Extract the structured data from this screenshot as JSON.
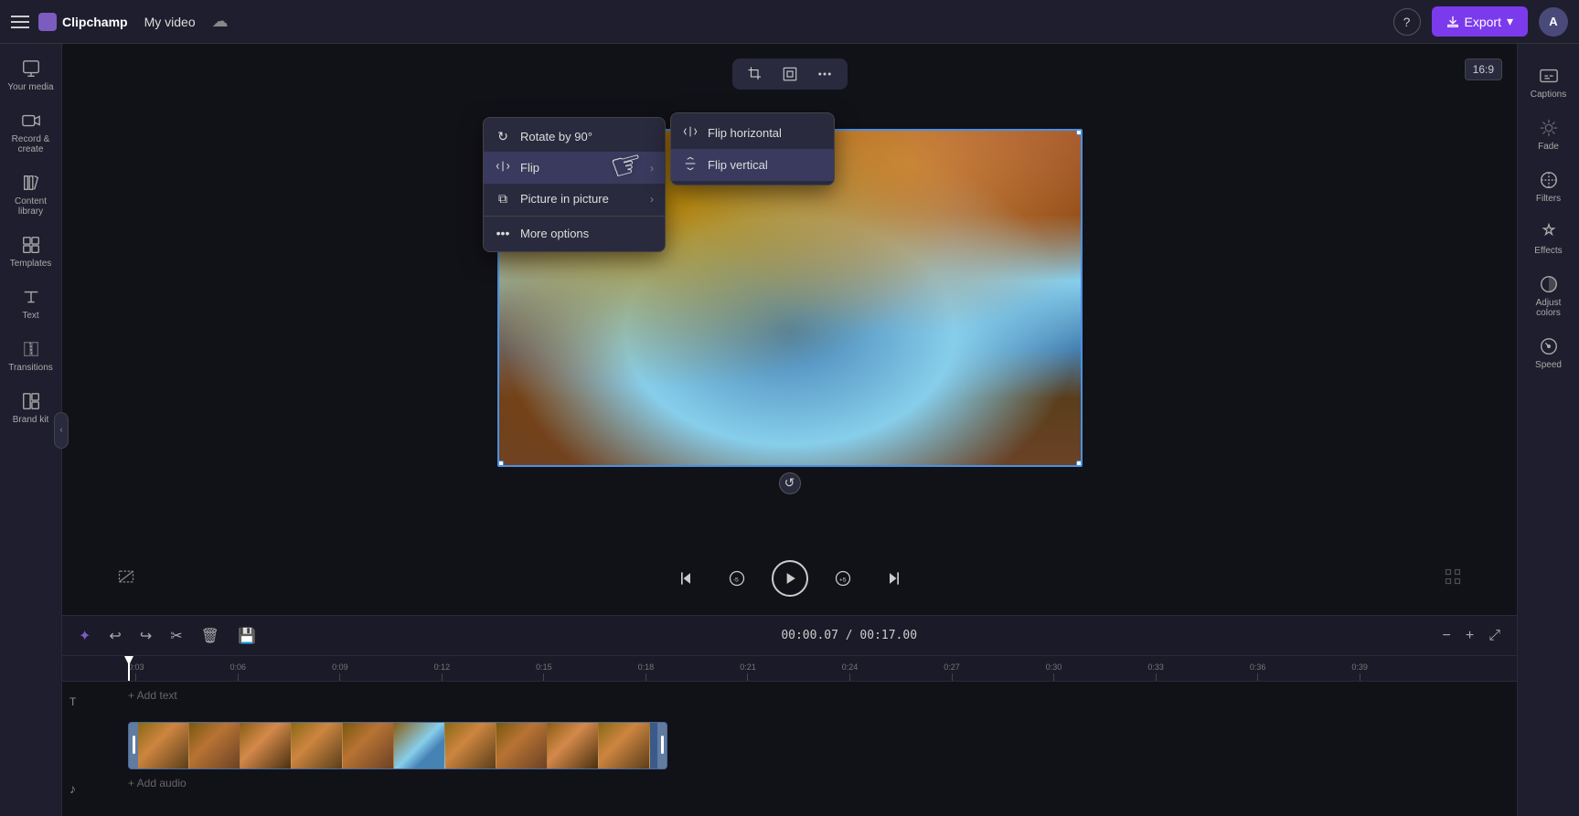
{
  "app": {
    "name": "Clipchamp",
    "project_name": "My video",
    "export_label": "Export"
  },
  "topbar": {
    "hamburger_label": "Menu",
    "logo_alt": "Clipchamp logo",
    "help_label": "?",
    "avatar_label": "A"
  },
  "left_sidebar": {
    "items": [
      {
        "id": "your-media",
        "label": "Your media",
        "icon": "media-icon"
      },
      {
        "id": "record-create",
        "label": "Record & create",
        "icon": "record-icon"
      },
      {
        "id": "content-library",
        "label": "Content library",
        "icon": "library-icon"
      },
      {
        "id": "templates",
        "label": "Templates",
        "icon": "templates-icon"
      },
      {
        "id": "text",
        "label": "Text",
        "icon": "text-icon"
      },
      {
        "id": "transitions",
        "label": "Transitions",
        "icon": "transitions-icon"
      },
      {
        "id": "brand-kit",
        "label": "Brand kit",
        "icon": "brand-kit-icon"
      }
    ]
  },
  "right_sidebar": {
    "items": [
      {
        "id": "captions",
        "label": "Captions",
        "icon": "captions-icon"
      },
      {
        "id": "fade",
        "label": "Fade",
        "icon": "fade-icon"
      },
      {
        "id": "filters",
        "label": "Filters",
        "icon": "filters-icon"
      },
      {
        "id": "effects",
        "label": "Effects",
        "icon": "effects-icon"
      },
      {
        "id": "adjust-colors",
        "label": "Adjust colors",
        "icon": "adjust-colors-icon"
      },
      {
        "id": "speed",
        "label": "Speed",
        "icon": "speed-icon"
      }
    ]
  },
  "video_toolbar": {
    "crop_label": "Crop",
    "fit_label": "Fit",
    "more_options_label": "More options"
  },
  "aspect_ratio": {
    "label": "16:9"
  },
  "context_menu": {
    "items": [
      {
        "id": "rotate",
        "label": "Rotate by 90°",
        "icon": "↻",
        "has_arrow": false
      },
      {
        "id": "flip",
        "label": "Flip",
        "icon": "⟺",
        "has_arrow": true
      },
      {
        "id": "picture-in-picture",
        "label": "Picture in picture",
        "icon": "⧉",
        "has_arrow": true
      },
      {
        "id": "more-options",
        "label": "More options",
        "icon": "…",
        "has_arrow": false
      }
    ]
  },
  "flip_submenu": {
    "items": [
      {
        "id": "flip-horizontal",
        "label": "Flip horizontal",
        "icon": "↔"
      },
      {
        "id": "flip-vertical",
        "label": "Flip vertical",
        "icon": "↕"
      }
    ]
  },
  "playback": {
    "skip_back_label": "Skip to start",
    "rewind_label": "Rewind 5s",
    "play_label": "Play",
    "forward_label": "Forward 5s",
    "skip_end_label": "Skip to end",
    "fullscreen_label": "Fullscreen",
    "hide_label": "Hide"
  },
  "timeline": {
    "current_time": "00:00.07",
    "total_time": "00:17.00",
    "add_text_label": "+ Add text",
    "add_audio_label": "+ Add audio",
    "ruler_marks": [
      "0:03",
      "0:06",
      "0:09",
      "0:12",
      "0:15",
      "0:18",
      "0:21",
      "0:24",
      "0:27",
      "0:30",
      "0:33",
      "0:36",
      "0:39"
    ]
  }
}
